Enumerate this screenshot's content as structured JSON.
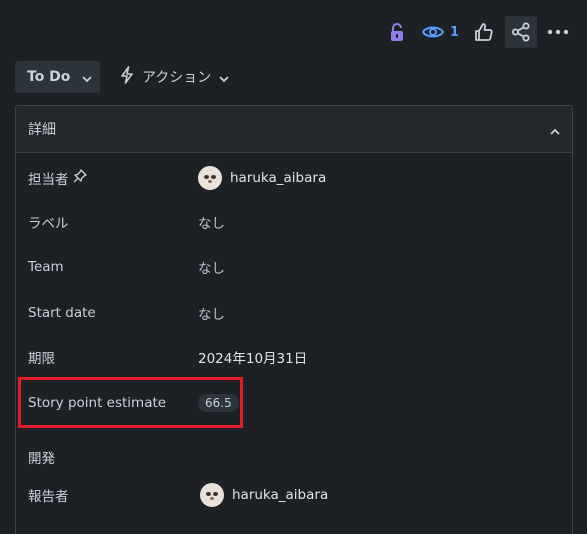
{
  "toolbar": {
    "lock_icon": "unlock-icon",
    "watch_icon": "eye-icon",
    "watch_count": "1",
    "like_icon": "thumbs-up-icon",
    "share_icon": "share-icon",
    "more_icon": "more-horizontal-icon",
    "accent_color": "#579dff",
    "lock_color": "#8f7ee7"
  },
  "status": {
    "label": "To Do"
  },
  "actions": {
    "label": "アクション"
  },
  "details": {
    "title": "詳細",
    "fields": {
      "assignee": {
        "label": "担当者",
        "value": "haruka_aibara"
      },
      "labels": {
        "label": "ラベル",
        "value": "なし"
      },
      "team": {
        "label": "Team",
        "value": "なし"
      },
      "start_date": {
        "label": "Start date",
        "value": "なし"
      },
      "due_date": {
        "label": "期限",
        "value": "2024年10月31日"
      },
      "story_points": {
        "label": "Story point estimate",
        "value": "66.5"
      },
      "development": {
        "label": "開発"
      },
      "reporter": {
        "label": "報告者",
        "value": "haruka_aibara"
      }
    }
  },
  "annotation": {
    "highlight_color": "#e21d26"
  }
}
